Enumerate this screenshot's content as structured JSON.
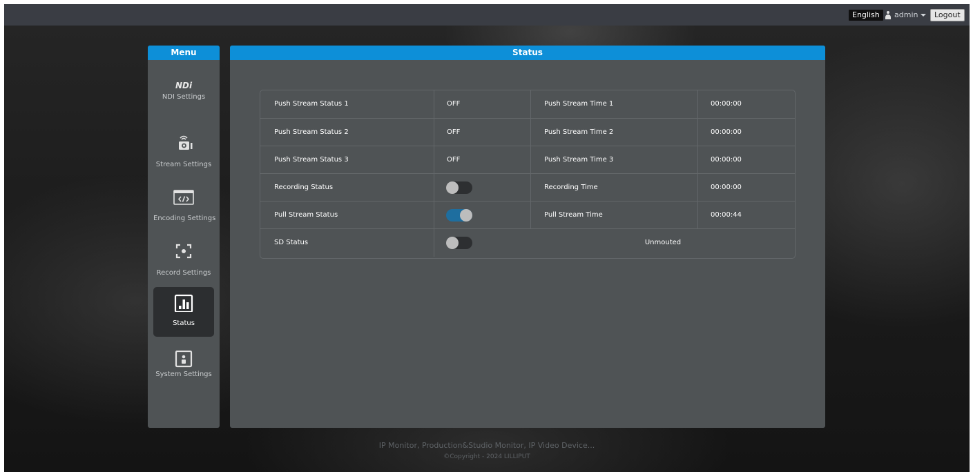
{
  "topbar": {
    "language": "English",
    "user": "admin",
    "logout": "Logout"
  },
  "menu": {
    "title": "Menu",
    "items": [
      {
        "label": "NDI Settings",
        "icon": "ndi-logo-icon",
        "logo_text": "NDi",
        "active": false
      },
      {
        "label": "Stream Settings",
        "icon": "stream-camera-icon",
        "active": false
      },
      {
        "label": "Encoding Settings",
        "icon": "code-window-icon",
        "active": false
      },
      {
        "label": "Record Settings",
        "icon": "record-frame-icon",
        "active": false
      },
      {
        "label": "Status",
        "icon": "bar-chart-icon",
        "active": true
      },
      {
        "label": "System Settings",
        "icon": "system-user-icon",
        "active": false
      }
    ]
  },
  "status": {
    "title": "Status",
    "rows": [
      {
        "label": "Push Stream Status 1",
        "value": "OFF",
        "time_label": "Push Stream Time 1",
        "time": "00:00:00"
      },
      {
        "label": "Push Stream Status 2",
        "value": "OFF",
        "time_label": "Push Stream Time 2",
        "time": "00:00:00"
      },
      {
        "label": "Push Stream Status 3",
        "value": "OFF",
        "time_label": "Push Stream Time 3",
        "time": "00:00:00"
      },
      {
        "label": "Recording Status",
        "toggle": false,
        "time_label": "Recording Time",
        "time": "00:00:00"
      },
      {
        "label": "Pull Stream Status",
        "toggle": true,
        "time_label": "Pull Stream Time",
        "time": "00:00:44"
      },
      {
        "label": "SD Status",
        "toggle": false,
        "sd_value": "Unmouted"
      }
    ]
  },
  "footer": {
    "line1": "IP Monitor, Production&Studio Monitor, IP Video Device...",
    "line2": "©Copyright - 2024 LILLIPUT"
  },
  "colors": {
    "accent": "#0d8fd8",
    "panel": "#4f5355",
    "toggle_on": "#1e6e9f"
  }
}
